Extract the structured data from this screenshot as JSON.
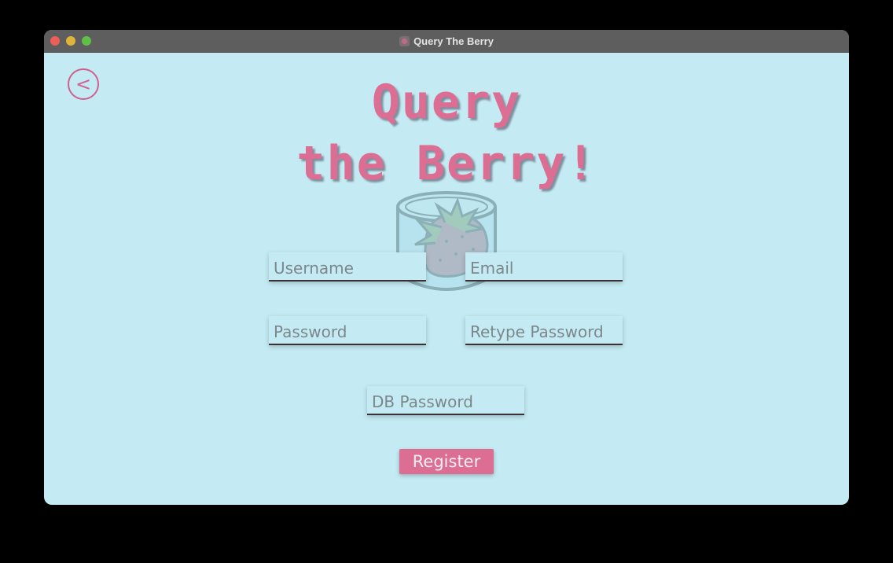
{
  "window": {
    "title": "Query The Berry"
  },
  "nav": {
    "back_label": "<"
  },
  "heading": {
    "line1": "Query",
    "line2": "the Berry!"
  },
  "form": {
    "username_placeholder": "Username",
    "email_placeholder": "Email",
    "password_placeholder": "Password",
    "retype_password_placeholder": "Retype Password",
    "db_password_placeholder": "DB Password",
    "register_label": "Register"
  },
  "colors": {
    "background": "#c4ebf3",
    "accent": "#dc6d93",
    "titlebar": "#5e5e5e"
  },
  "icons": {
    "logo": "strawberry-in-jar-icon",
    "back": "back-arrow-icon"
  }
}
